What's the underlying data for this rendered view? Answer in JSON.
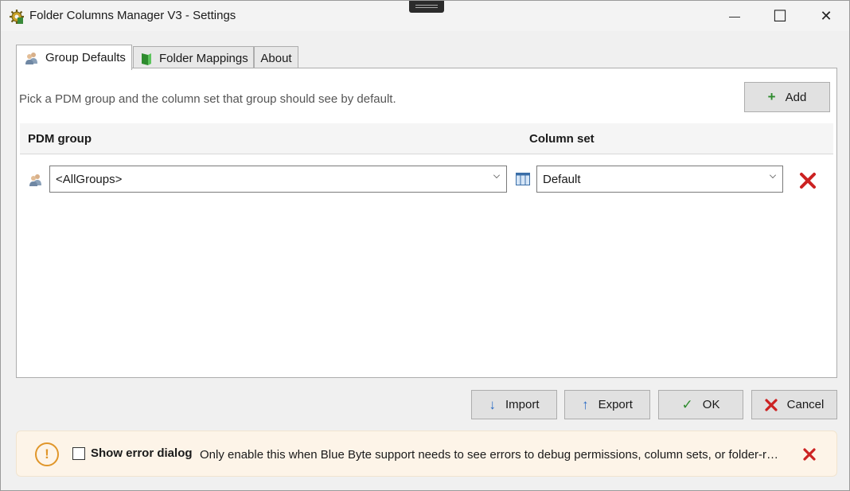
{
  "window": {
    "title": "Folder Columns Manager V3 - Settings",
    "minimize_glyph": "—",
    "maximize_glyph": "☐",
    "close_glyph": "✕"
  },
  "tabs": [
    {
      "label": "Group Defaults",
      "icon": "group-users-icon",
      "active": true
    },
    {
      "label": "Folder Mappings",
      "icon": "green-folder-icon",
      "active": false
    },
    {
      "label": "About",
      "active": false
    }
  ],
  "group_defaults": {
    "intro": "Pick a PDM group and the column set that group should see by default.",
    "add_label": "Add",
    "add_icon": "+",
    "columns": {
      "group": "PDM group",
      "set": "Column set"
    },
    "rows": [
      {
        "group": "<AllGroups>",
        "column_set": "Default"
      }
    ]
  },
  "actions": {
    "import_label": "Import",
    "export_label": "Export",
    "ok_label": "OK",
    "cancel_label": "Cancel",
    "import_icon": "↓",
    "export_icon": "↑",
    "ok_icon": "✓"
  },
  "warning": {
    "icon_text": "!",
    "checkbox_label": "Show error dialog",
    "checked": false,
    "message": "Only enable this when Blue Byte support needs to see errors to debug permissions, column sets, or folder-rel..."
  },
  "colors": {
    "accent_red": "#cc2222",
    "accent_green": "#2e8b2e",
    "accent_blue": "#2a6bc4",
    "warning_orange": "#e0962a"
  }
}
